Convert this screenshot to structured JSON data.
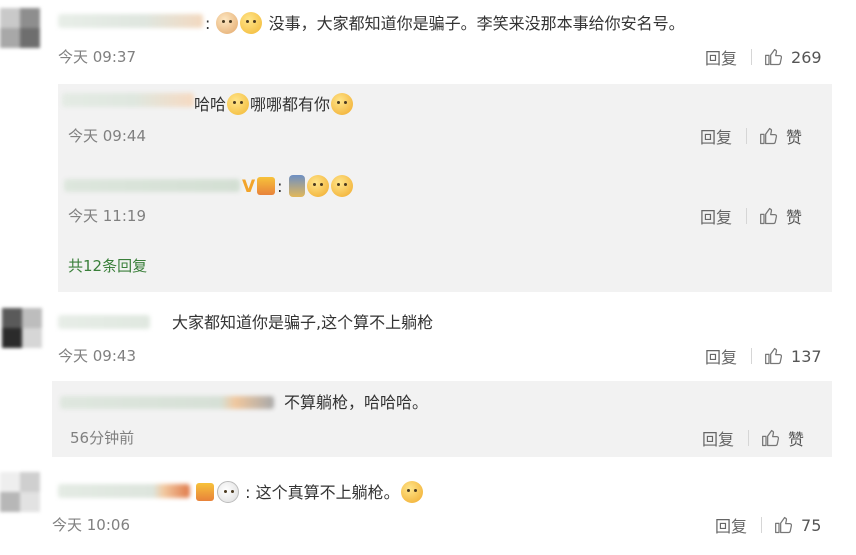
{
  "comments": [
    {
      "text_prefix": ":",
      "text": "没事，大家都知道你是骗子。李笑来没那本事给你安名号。",
      "time": "今天 09:37",
      "reply_label": "回复",
      "likes": "269"
    },
    {
      "text": "大家都知道你是骗子,这个算不上躺枪",
      "time": "今天 09:43",
      "reply_label": "回复",
      "likes": "137"
    },
    {
      "text_prefix": ":",
      "text": "这个真算不上躺枪。",
      "time": "今天 10:06",
      "reply_label": "回复",
      "likes": "75"
    }
  ],
  "replies_1": [
    {
      "text_a": "哈哈",
      "text_b": "哪哪都有你",
      "time": "今天 09:44",
      "reply_label": "回复",
      "like_label": "赞"
    },
    {
      "vmark": "V",
      "text_prefix": ":",
      "time": "今天 11:19",
      "reply_label": "回复",
      "like_label": "赞"
    }
  ],
  "more_replies": "共12条回复",
  "reply_2": {
    "text": "不算躺枪，哈哈哈。",
    "time": "56分钟前",
    "reply_label": "回复",
    "like_label": "赞"
  },
  "icons": {
    "like": "thumbs-up-icon",
    "emoji": [
      "cat-emoji",
      "dog-emoji",
      "laugh-emoji",
      "panda-emoji",
      "figure-emoji",
      "member-badge"
    ]
  },
  "colors": {
    "link_green": "#3a7f3a",
    "reply_box_bg": "#f2f2f2",
    "meta_gray": "#808080"
  }
}
